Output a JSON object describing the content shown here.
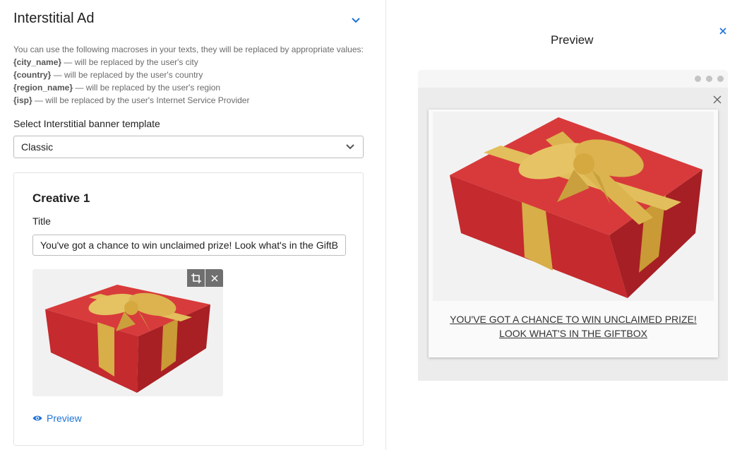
{
  "left": {
    "title": "Interstitial Ad",
    "help": {
      "intro": "You can use the following macroses in your texts, they will be replaced by appropriate values:",
      "macros": [
        {
          "token": "{city_name}",
          "desc": " — will be replaced by the user's city"
        },
        {
          "token": "{country}",
          "desc": " — will be replaced by the user's country"
        },
        {
          "token": "{region_name}",
          "desc": " — will be replaced by the user's region"
        },
        {
          "token": "{isp}",
          "desc": " — will be replaced by the user's Internet Service Provider"
        }
      ]
    },
    "template_label": "Select Interstitial banner template",
    "template_value": "Classic",
    "creative": {
      "title": "Creative 1",
      "field_label": "Title",
      "field_value": "You've got a chance to win unclaimed prize! Look what's in the GiftBox",
      "preview_label": "Preview"
    }
  },
  "right": {
    "title": "Preview",
    "ad_text": "YOU'VE GOT A CHANCE TO WIN UNCLAIMED PRIZE! LOOK WHAT'S IN THE GIFTBOX"
  },
  "colors": {
    "accent": "#1e73d8",
    "box_red": "#c8262b",
    "ribbon_gold": "#d8b04a"
  }
}
